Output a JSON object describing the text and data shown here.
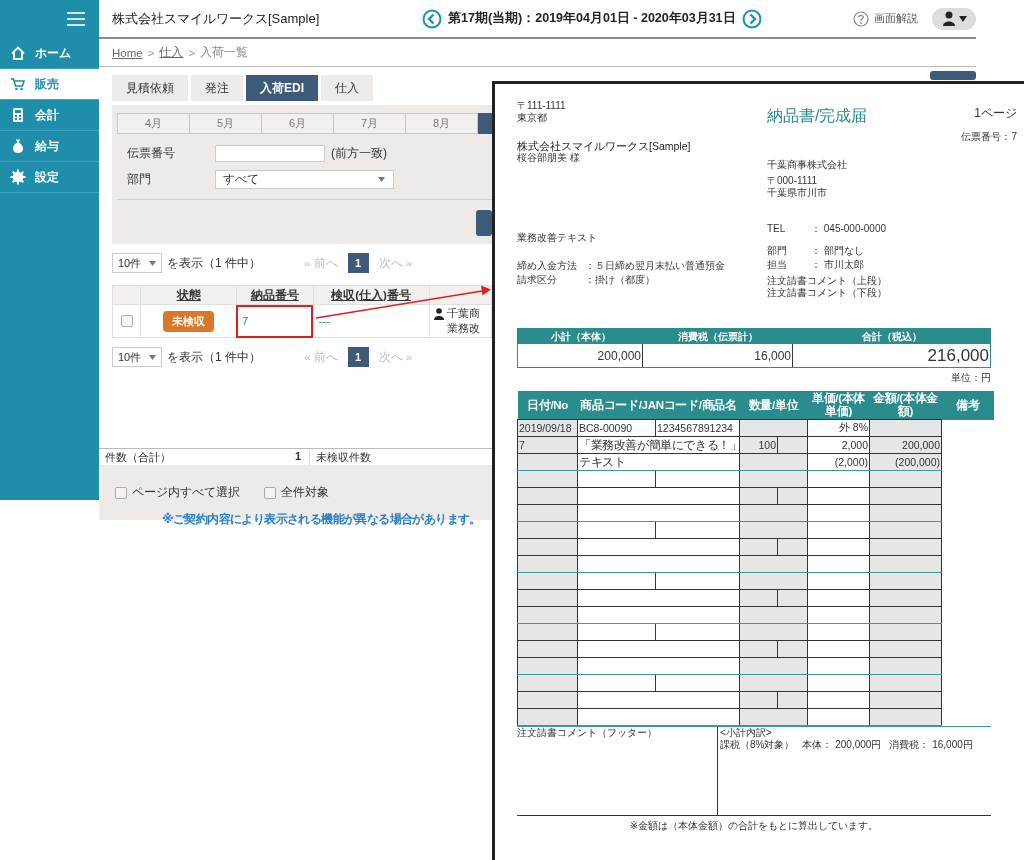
{
  "app": {
    "sidebar": [
      {
        "label": "ホーム",
        "selected": false
      },
      {
        "label": "販売",
        "selected": true
      },
      {
        "label": "会計",
        "selected": false
      },
      {
        "label": "給与",
        "selected": false
      },
      {
        "label": "設定",
        "selected": false
      }
    ],
    "header": {
      "company": "株式会社スマイルワークス[Sample]",
      "period": "第17期(当期)：2019年04月01日 - 2020年03月31日",
      "help": "画面解説"
    },
    "breadcrumb": [
      {
        "label": "Home",
        "kind": "link"
      },
      {
        "label": ">",
        "kind": "separator"
      },
      {
        "label": "仕入",
        "kind": "link"
      },
      {
        "label": ">",
        "kind": "separator"
      },
      {
        "label": "入荷一覧",
        "kind": "current"
      }
    ],
    "tabs": [
      {
        "label": "見積依頼",
        "selected": false
      },
      {
        "label": "発注",
        "selected": false
      },
      {
        "label": "入荷EDI",
        "selected": true
      },
      {
        "label": "仕入",
        "selected": false
      }
    ],
    "months": [
      {
        "label": "4月",
        "selected": false
      },
      {
        "label": "5月",
        "selected": false
      },
      {
        "label": "6月",
        "selected": false
      },
      {
        "label": "7月",
        "selected": false
      },
      {
        "label": "8月",
        "selected": false
      },
      {
        "selected": true
      }
    ],
    "filters": {
      "slip_label": "伝票番号",
      "slip_hint": "(前方一致)",
      "dept_label": "部門",
      "dept_value": "すべて"
    },
    "pagers": [
      {
        "page_size": "10件",
        "summary": "を表示（1 件中）",
        "prev": "«  前へ",
        "page": "1",
        "next": "次へ  »"
      },
      {
        "page_size": "10件",
        "summary": "を表示（1 件中）",
        "prev": "«  前へ",
        "page": "1",
        "next": "次へ  »"
      }
    ],
    "table": {
      "columns": [
        "状態",
        "納品番号",
        "検収(仕入)番号"
      ],
      "rows": [
        {
          "checked": false,
          "status": "未検収",
          "number": "7",
          "highlighted": true,
          "inspection": "---",
          "supplier": "千葉商",
          "supplier_note": "業務改"
        }
      ]
    },
    "summary": {
      "count_label": "件数（合計）",
      "count": "1",
      "pending_label": "未検収件数"
    },
    "bulk": [
      {
        "label": "ページ内すべて選択",
        "checked": false
      },
      {
        "label": "全件対象",
        "checked": false
      }
    ],
    "notice": "※ご契約内容により表示される機能が異なる場合があります。"
  },
  "document": {
    "sender": {
      "postal": "〒111-1111",
      "address": "東京都",
      "company": "株式会社スマイルワークス[Sample]",
      "person": "桜谷部朋美 様"
    },
    "title": "納品書/完成届",
    "page": "1ページ",
    "slip": "伝票番号：7",
    "recipient": {
      "company": "千葉商事株式会社",
      "postal": "〒000-1111",
      "address": "千葉県市川市"
    },
    "note": "業務改善テキスト",
    "left_fields": [
      {
        "label": "締め入金方法",
        "value": "：５日締め翌月末払い普通預金"
      },
      {
        "label": "請求区分",
        "value": "：掛け（都度）"
      }
    ],
    "right_fields": [
      {
        "label": "TEL",
        "value": "： 045-000-0000"
      },
      {
        "label": "部門",
        "value": "： 部門なし"
      },
      {
        "label": "担当",
        "value": "： 市川太郎"
      }
    ],
    "comments": [
      "注文請書コメント（上段）",
      "注文請書コメント（下段）"
    ],
    "totals": [
      {
        "label": "小計（本体）",
        "value": "200,000",
        "kind": "sum"
      },
      {
        "label": "消費税（伝票計）",
        "value": "16,000",
        "kind": "sum"
      },
      {
        "label": "合計（税込）",
        "value": "216,000",
        "kind": "grand"
      }
    ],
    "unit": "単位：円",
    "columns": [
      "日付/No",
      "商品コード/JANコード/商品名",
      "数量/単位",
      "単価/(本体単価)",
      "金額/(本体金額)",
      "備考"
    ],
    "items": [
      {
        "date": "2019/09/18",
        "no": "7",
        "code": "BC8-00090",
        "jan": "1234567891234",
        "name": "「業務改善が簡単にできる！」",
        "name2": "テキスト",
        "quantity": "100",
        "tax": "外 8%",
        "unit_price": "2,000",
        "amount": "200,000",
        "base_unit_price": "(2,000)",
        "base_amount": "(200,000)"
      }
    ],
    "footer_comment": "注文請書コメント（フッター）",
    "breakdown": {
      "title": "<小計内訳>",
      "rate": "課税（8%対象）",
      "base": "本体： 200,000円",
      "tax": "消費税： 16,000円"
    },
    "footnote": "※金額は（本体金額）の合計をもとに算出しています。"
  }
}
